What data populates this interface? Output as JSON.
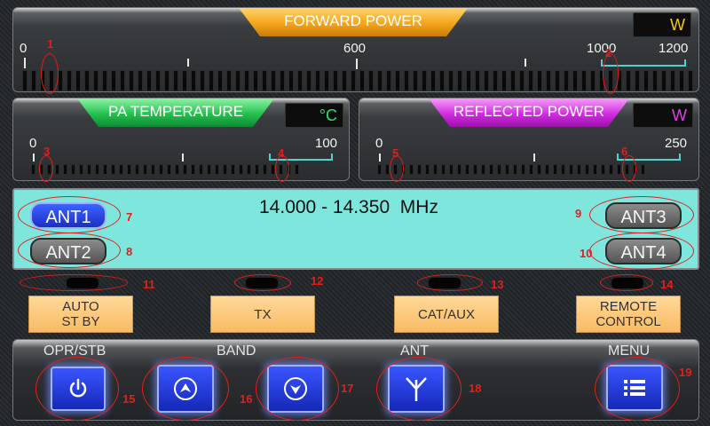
{
  "forward_power": {
    "title": "FORWARD POWER",
    "unit": "W",
    "scale": [
      "0",
      "600",
      "1000",
      "1200"
    ]
  },
  "pa_temperature": {
    "title": "PA TEMPERATURE",
    "unit": "°C",
    "scale": [
      "0",
      "100"
    ]
  },
  "reflected_power": {
    "title": "REFLECTED POWER",
    "unit": "W",
    "scale": [
      "0",
      "250"
    ]
  },
  "antenna": {
    "frequency": "14.000 - 14.350  MHz",
    "ant1": "ANT1",
    "ant2": "ANT2",
    "ant3": "ANT3",
    "ant4": "ANT4",
    "selected": "ANT1"
  },
  "modes": {
    "auto_standby": "AUTO\nST BY",
    "tx": "TX",
    "cat_aux": "CAT/AUX",
    "remote_control": "REMOTE\nCONTROL"
  },
  "controls": {
    "opr_stb": "OPR/STB",
    "band": "BAND",
    "ant": "ANT",
    "menu": "MENU"
  },
  "annotations": [
    "1",
    "2",
    "3",
    "4",
    "5",
    "6",
    "7",
    "8",
    "9",
    "10",
    "11",
    "12",
    "13",
    "14",
    "15",
    "16",
    "17",
    "18",
    "19"
  ],
  "colors": {
    "forward": "#f3a51a",
    "temp": "#24c04d",
    "reflected": "#d22be0",
    "antenna_bg": "#7fe6de",
    "selected_button": "#1c2fc2",
    "temp_unit": "#2ee07a",
    "reflected_unit": "#e23ee8",
    "forward_unit": "#f5c518"
  }
}
